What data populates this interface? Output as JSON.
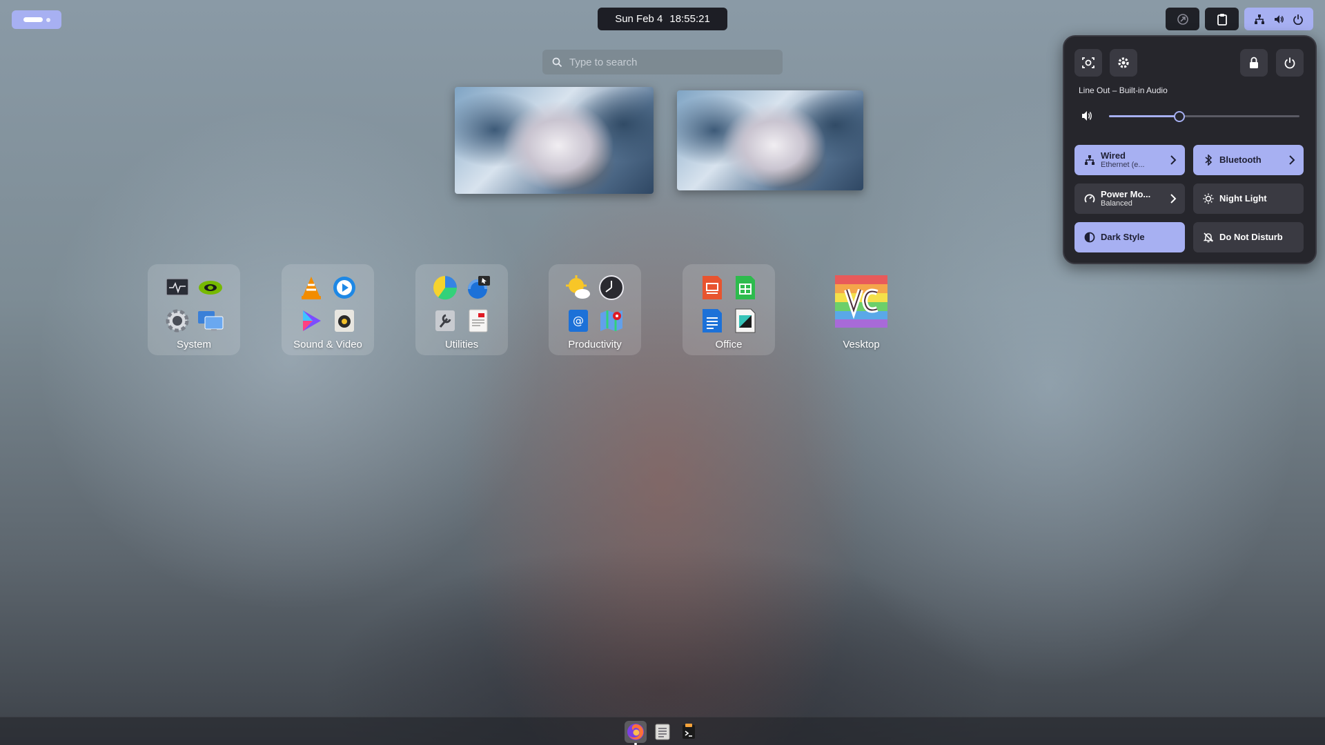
{
  "top_bar": {
    "clock_date": "Sun Feb 4",
    "clock_time": "18:55:21",
    "activities_icon": "workspace-indicator-icon",
    "tray_icons": [
      "extension-icon",
      "clipboard-icon",
      "network-wired-icon",
      "volume-icon",
      "power-icon"
    ]
  },
  "search": {
    "placeholder": "Type to search",
    "icon": "search-icon"
  },
  "app_grid": [
    {
      "label": "System",
      "icons": [
        "system-monitor-icon",
        "nvidia-settings-icon",
        "settings-gear-icon",
        "remote-desktop-icon"
      ]
    },
    {
      "label": "Sound & Video",
      "icons": [
        "vlc-icon",
        "media-player-icon",
        "video-app-icon",
        "rhythmbox-icon"
      ]
    },
    {
      "label": "Utilities",
      "icons": [
        "disk-usage-icon",
        "screenshot-icon",
        "system-tool-icon",
        "document-viewer-icon"
      ]
    },
    {
      "label": "Productivity",
      "icons": [
        "weather-icon",
        "clock-icon",
        "contacts-icon",
        "maps-icon"
      ]
    },
    {
      "label": "Office",
      "icons": [
        "impress-icon",
        "calc-icon",
        "writer-icon",
        "draw-icon"
      ]
    },
    {
      "label": "Vesktop",
      "icons": [
        "vesktop-icon"
      ]
    }
  ],
  "quick_settings": {
    "audio_device": "Line Out – Built-in Audio",
    "volume_fraction": 0.37,
    "buttons": [
      "screenshot-icon",
      "settings-icon",
      "lock-icon",
      "power-icon"
    ],
    "tiles": {
      "wired": {
        "title": "Wired",
        "subtitle": "Ethernet (e...",
        "on": true
      },
      "bluetooth": {
        "title": "Bluetooth",
        "on": true
      },
      "power_mode": {
        "title": "Power Mo...",
        "subtitle": "Balanced",
        "on": false
      },
      "night_light": {
        "title": "Night Light",
        "on": false
      },
      "dark_style": {
        "title": "Dark Style",
        "on": true
      },
      "dnd": {
        "title": "Do Not Disturb",
        "on": false
      }
    }
  },
  "dock": {
    "items": [
      "firefox-icon",
      "text-editor-icon",
      "terminal-icon"
    ],
    "active": "firefox-icon"
  },
  "colors": {
    "accent": "#a7b0f2",
    "panel": "#26262c",
    "tile_off": "#3a3a42"
  }
}
